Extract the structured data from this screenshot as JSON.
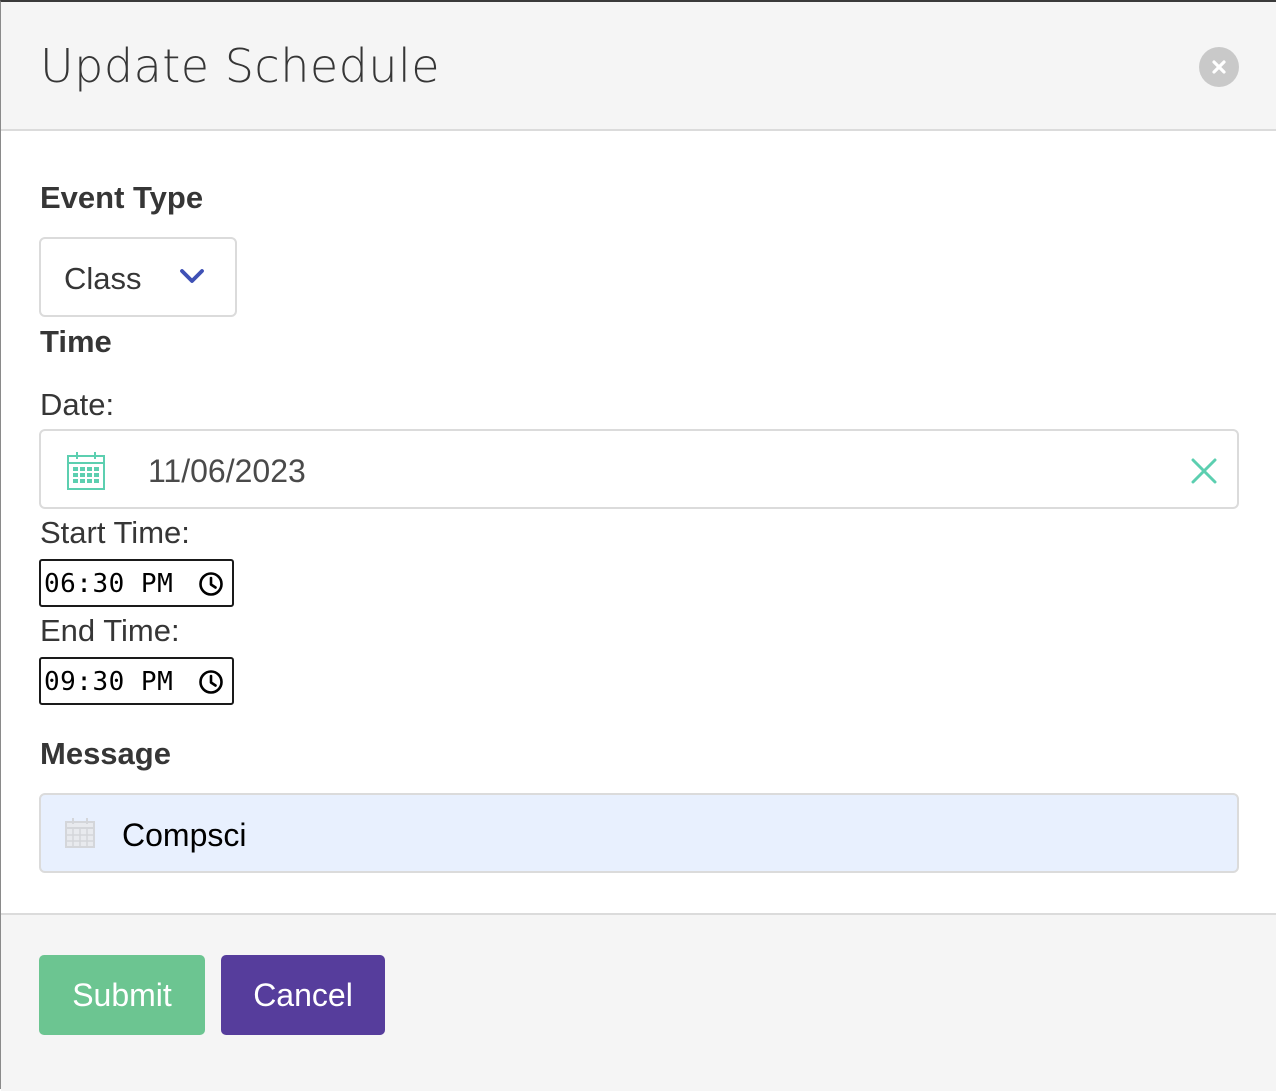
{
  "modal": {
    "title": "Update Schedule"
  },
  "event_type": {
    "heading": "Event Type",
    "selected": "Class"
  },
  "time": {
    "heading": "Time",
    "date_label": "Date:",
    "date_value": "11/06/2023",
    "start_label": "Start Time:",
    "start_value": "06:30 PM",
    "end_label": "End Time:",
    "end_value": "09:30 PM"
  },
  "message": {
    "heading": "Message",
    "value": "Compsci"
  },
  "footer": {
    "submit_label": "Submit",
    "cancel_label": "Cancel"
  },
  "icons": {
    "close": "close-icon",
    "select_arrow": "chevron-down-icon",
    "date": "calendar-icon",
    "clear": "x-icon",
    "clock": "clock-icon",
    "message": "calendar-icon"
  },
  "colors": {
    "header_bg": "#f5f5f5",
    "submit": "#6cc591",
    "cancel": "#563d9c",
    "accent_teal": "#5ccfb0",
    "chevron": "#3f51b5",
    "autofill_bg": "#e8f0fe"
  }
}
